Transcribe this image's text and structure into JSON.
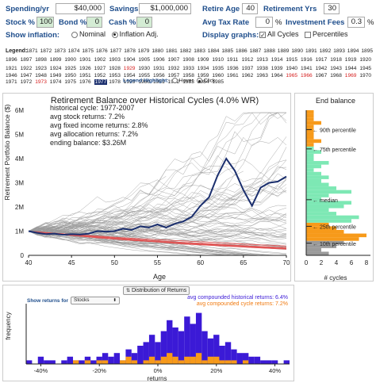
{
  "inputs": {
    "spending": {
      "label": "Spending/yr",
      "value": "$40,000"
    },
    "savings": {
      "label": "Savings",
      "value": "$1,000,000"
    },
    "retire_age": {
      "label": "Retire Age",
      "value": "40"
    },
    "retirement_yrs": {
      "label": "Retirement Yrs",
      "value": "30"
    },
    "stock": {
      "label": "Stock %",
      "value": "100"
    },
    "bond": {
      "label": "Bond %",
      "value": "0"
    },
    "cash": {
      "label": "Cash %",
      "value": "0"
    },
    "avg_tax": {
      "label": "Avg Tax Rate",
      "value": "0",
      "unit": "%"
    },
    "inv_fees": {
      "label": "Investment Fees",
      "value": "0.3",
      "unit": "%"
    },
    "show_inflation": {
      "label": "Show inflation:",
      "opt1": "Nominal",
      "opt2": "Inflation Adj."
    },
    "display_graphs": {
      "label": "Display graphs:",
      "opt1": "All Cycles",
      "opt2": "Percentiles"
    }
  },
  "legend": {
    "label": "Legend:",
    "years": [
      "1871",
      "1872",
      "1873",
      "1874",
      "1875",
      "1876",
      "1877",
      "1878",
      "1879",
      "1880",
      "1881",
      "1882",
      "1883",
      "1884",
      "1885",
      "1886",
      "1887",
      "1888",
      "1889",
      "1890",
      "1891",
      "1892",
      "1893",
      "1894",
      "1895",
      "1896",
      "1897",
      "1898",
      "1899",
      "1900",
      "1901",
      "1902",
      "1903",
      "1904",
      "1905",
      "1906",
      "1907",
      "1908",
      "1909",
      "1910",
      "1911",
      "1912",
      "1913",
      "1914",
      "1915",
      "1916",
      "1917",
      "1918",
      "1919",
      "1920",
      "1921",
      "1922",
      "1923",
      "1924",
      "1925",
      "1926",
      "1927",
      "1928",
      "1929",
      "1930",
      "1931",
      "1932",
      "1933",
      "1934",
      "1935",
      "1936",
      "1937",
      "1938",
      "1939",
      "1940",
      "1941",
      "1942",
      "1943",
      "1944",
      "1945",
      "1946",
      "1947",
      "1948",
      "1949",
      "1950",
      "1951",
      "1952",
      "1953",
      "1954",
      "1955",
      "1956",
      "1957",
      "1958",
      "1959",
      "1960",
      "1961",
      "1962",
      "1963",
      "1964",
      "1965",
      "1966",
      "1967",
      "1968",
      "1969",
      "1970",
      "1971",
      "1972",
      "1973",
      "1974",
      "1975",
      "1976",
      "1977",
      "1978",
      "1979",
      "1980",
      "1981",
      "1982",
      "1983",
      "1984",
      "1985"
    ],
    "red_years": [
      "1929",
      "1965",
      "1966",
      "1969",
      "1973"
    ],
    "selected_year": "1977",
    "highlight_label": "Legend Highlight:",
    "hover": "Hover",
    "click": "Click"
  },
  "main_chart": {
    "title": "Retirement Balance over Historical Cycles (4.0% WR)",
    "ylabel": "Retirement Portfolio Balance ($)",
    "xlabel": "Age",
    "y_ticks": [
      "0",
      "1M",
      "2M",
      "3M",
      "4M",
      "5M",
      "6M"
    ],
    "x_ticks": [
      "40",
      "45",
      "50",
      "55",
      "60",
      "65",
      "70"
    ],
    "stats": [
      "historical cycle: 1977-2007",
      "avg stock returns: 7.2%",
      "avg fixed income returns: 2.8%",
      "avg allocation returns: 7.2%",
      "ending balance: $3.26M"
    ]
  },
  "chart_data": [
    {
      "type": "line",
      "title": "Retirement Balance over Historical Cycles (4.0% WR)",
      "xlabel": "Age",
      "ylabel": "Retirement Portfolio Balance ($)",
      "xlim": [
        40,
        70
      ],
      "ylim": [
        0,
        6000000
      ],
      "series": [
        {
          "name": "1977-2007",
          "x": [
            40,
            41,
            42,
            43,
            44,
            45,
            46,
            47,
            48,
            49,
            50,
            51,
            52,
            53,
            54,
            55,
            56,
            57,
            58,
            59,
            60,
            61,
            62,
            63,
            64,
            65,
            66,
            67,
            68,
            69,
            70
          ],
          "y": [
            1000000,
            930000,
            880000,
            900000,
            850000,
            880000,
            860000,
            900000,
            1000000,
            980000,
            1000000,
            1100000,
            1050000,
            1200000,
            1150000,
            1280000,
            1150000,
            1300000,
            1400000,
            1600000,
            2050000,
            2400000,
            3300000,
            4000000,
            3500000,
            2700000,
            2050000,
            2800000,
            3000000,
            3050000,
            3260000
          ]
        }
      ]
    },
    {
      "type": "bar",
      "title": "End balance",
      "xlabel": "# cycles",
      "x_ticks": [
        "0",
        "2",
        "4",
        "6",
        "8"
      ],
      "y_ticks": [
        "0",
        "1M",
        "2M",
        "3M",
        "4M",
        "5M",
        "6M"
      ],
      "percentiles": [
        "90th percentile",
        "75th percentile",
        "median",
        "25th percentile",
        "10th percentile"
      ]
    },
    {
      "type": "bar",
      "title": "Distribution of Returns",
      "xlabel": "returns",
      "ylabel": "frequency",
      "x_ticks": [
        "-40%",
        "-20%",
        "0%",
        "20%",
        "40%"
      ],
      "series": [
        {
          "name": "avg compounded historical returns: 6.4%"
        },
        {
          "name": "avg compounded cycle returns: 7.2%"
        }
      ]
    }
  ],
  "returns": {
    "show_label": "Show returns for",
    "select_value": "Stocks",
    "title_button": "Distribution of Returns",
    "hist_legend": "avg compounded historical returns: 6.4%",
    "cycle_legend": "avg compounded cycle returns: 7.2%"
  },
  "end_balance": {
    "title": "End balance",
    "xlabel": "# cycles",
    "arrow_median": "median"
  },
  "colors": {
    "selected": "#1b2f6e",
    "fail": "#d62020",
    "green": "#7de8b4",
    "orange": "#f79a1a",
    "purple": "#3b1ad6",
    "label": "#1f4e8c"
  }
}
